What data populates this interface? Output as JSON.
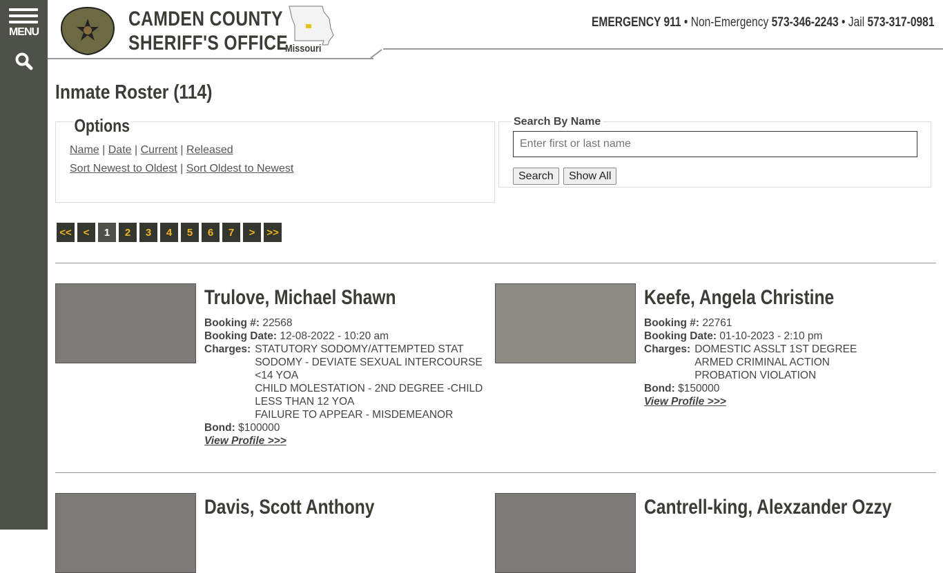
{
  "sidebar": {
    "menu_label": "MENU"
  },
  "header": {
    "title_line1": "CAMDEN COUNTY",
    "title_line2": "SHERIFF'S OFFICE",
    "state": "Missouri",
    "badge_text": "CAMDEN COUNTY SHERIFF",
    "emergency_label": "EMERGENCY 911",
    "nonemergency_label": "Non-Emergency",
    "nonemergency_phone": "573-346-2243",
    "jail_label": "Jail",
    "jail_phone": "573-317-0981",
    "separator": "•"
  },
  "page_title": "Inmate Roster (114)",
  "options": {
    "heading": "Options",
    "sort_links": [
      "Name",
      "Date",
      "Current",
      "Released"
    ],
    "order_links": [
      "Sort Newest to Oldest",
      "Sort Oldest to Newest"
    ],
    "sep": "|"
  },
  "search": {
    "heading": "Search By Name",
    "placeholder": "Enter first or last name",
    "value": "",
    "search_label": "Search",
    "show_all_label": "Show All"
  },
  "pagination": {
    "first": "<<",
    "prev": "<",
    "pages": [
      "1",
      "2",
      "3",
      "4",
      "5",
      "6",
      "7"
    ],
    "current": "1",
    "next": ">",
    "last": ">>"
  },
  "labels": {
    "booking_no": "Booking #:",
    "booking_date": "Booking Date:",
    "charges": "Charges:",
    "bond": "Bond:",
    "view_profile": "View Profile >>>"
  },
  "inmates": [
    {
      "name": "Trulove, Michael Shawn",
      "booking_no": "22568",
      "booking_date": "12-08-2022 - 10:20 am",
      "charges": [
        "STATUTORY SODOMY/ATTEMPTED STAT SODOMY - DEVIATE SEXUAL INTERCOURSE <14 YOA",
        "CHILD MOLESTATION - 2ND DEGREE -CHILD LESS THAN 12 YOA",
        "FAILURE TO APPEAR - MISDEMEANOR"
      ],
      "bond": "$100000"
    },
    {
      "name": "Keefe, Angela Christine",
      "booking_no": "22761",
      "booking_date": "01-10-2023 - 2:10 pm",
      "charges": [
        "DOMESTIC ASSLT 1ST DEGREE",
        "ARMED CRIMINAL ACTION",
        "PROBATION VIOLATION"
      ],
      "bond": "$150000"
    },
    {
      "name": "Davis, Scott Anthony"
    },
    {
      "name": "Cantrell-king, Alexzander Ozzy"
    }
  ]
}
